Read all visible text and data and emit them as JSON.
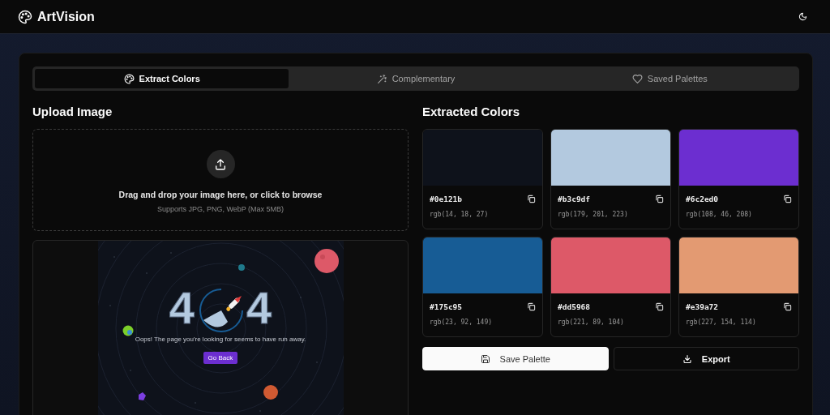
{
  "app": {
    "title": "ArtVision"
  },
  "tabs": [
    {
      "label": "Extract Colors",
      "kind": "palette",
      "selected": true
    },
    {
      "label": "Complementary",
      "kind": "wand",
      "selected": false
    },
    {
      "label": "Saved Palettes",
      "kind": "heart",
      "selected": false
    }
  ],
  "upload": {
    "heading": "Upload Image",
    "prompt": "Drag and drop your image here, or click to browse",
    "hint": "Supports JPG, PNG, WebP (Max 5MB)"
  },
  "preview": {
    "digits": [
      "4",
      "4"
    ],
    "message": "Oops! The page you're looking for seems to have run away.",
    "button": "Go Back"
  },
  "colors_heading": "Extracted Colors",
  "colors": [
    {
      "hex": "#0e121b",
      "rgb": "rgb(14, 18, 27)",
      "color": "#0e121b"
    },
    {
      "hex": "#b3c9df",
      "rgb": "rgb(179, 201, 223)",
      "color": "#b3c9df"
    },
    {
      "hex": "#6c2ed0",
      "rgb": "rgb(108, 46, 208)",
      "color": "#6c2ed0"
    },
    {
      "hex": "#175c95",
      "rgb": "rgb(23, 92, 149)",
      "color": "#175c95"
    },
    {
      "hex": "#dd5968",
      "rgb": "rgb(221, 89, 104)",
      "color": "#dd5968"
    },
    {
      "hex": "#e39a72",
      "rgb": "rgb(227, 154, 114)",
      "color": "#e39a72"
    }
  ],
  "actions": [
    {
      "label": "Save Palette",
      "kind": "primary"
    },
    {
      "label": "Export",
      "kind": "outline"
    }
  ]
}
